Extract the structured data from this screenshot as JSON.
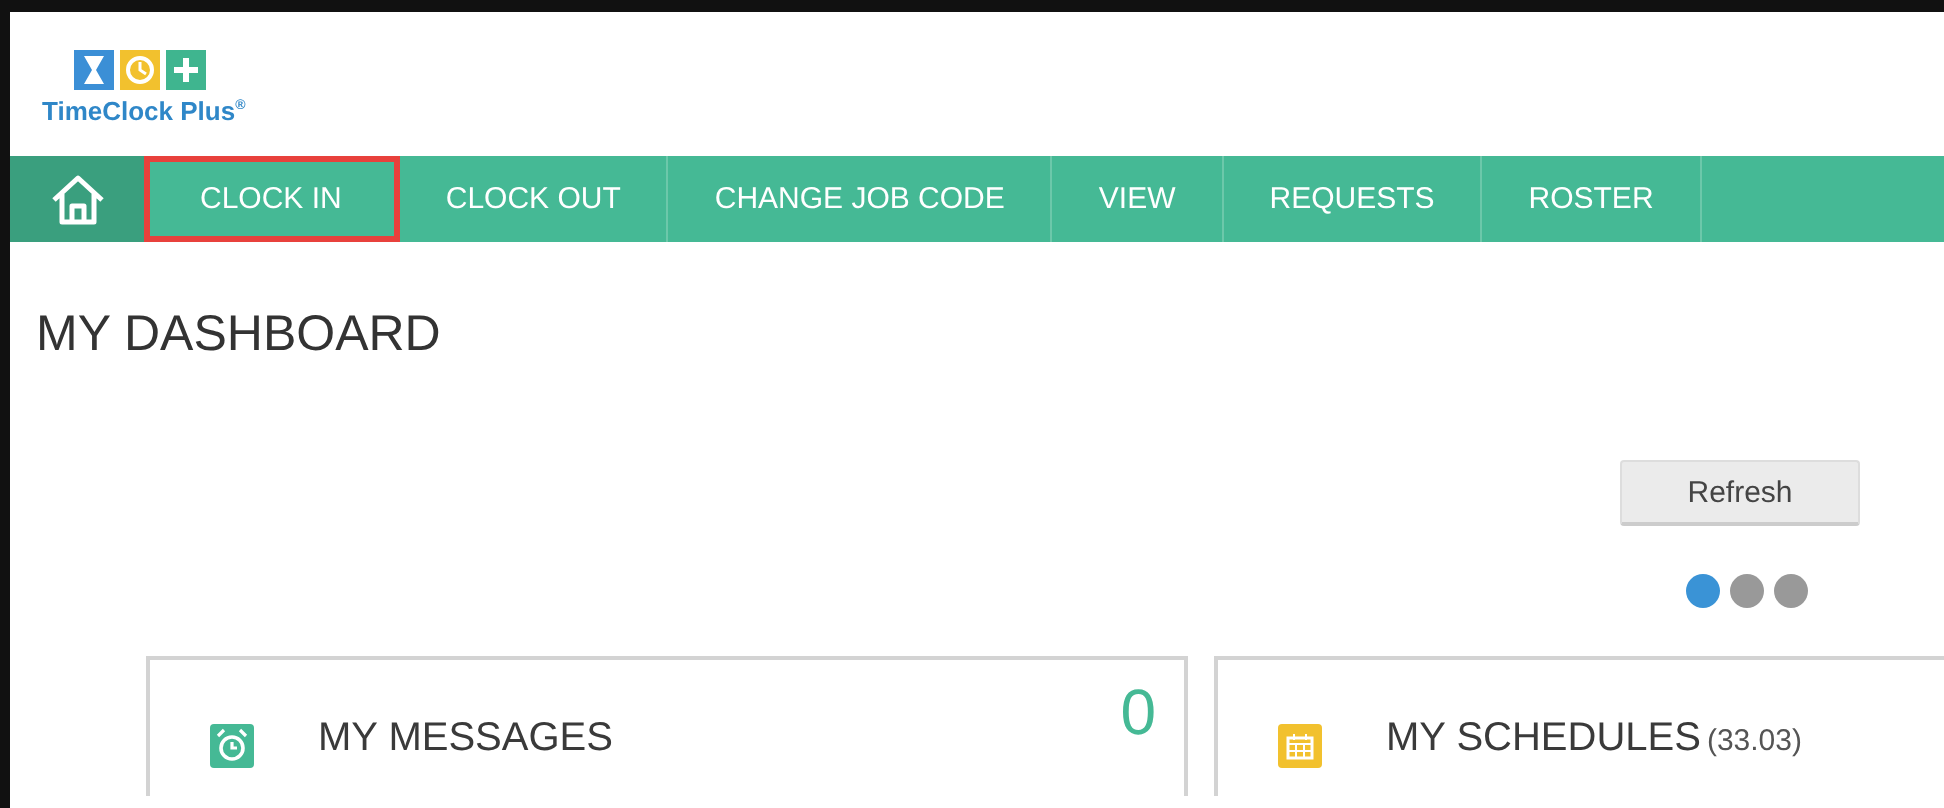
{
  "logo": {
    "text": "TimeClock Plus",
    "mark": "®"
  },
  "nav": {
    "items": [
      {
        "label": "CLOCK IN",
        "highlighted": true
      },
      {
        "label": "CLOCK OUT",
        "highlighted": false
      },
      {
        "label": "CHANGE JOB CODE",
        "highlighted": false
      },
      {
        "label": "VIEW",
        "highlighted": false
      },
      {
        "label": "REQUESTS",
        "highlighted": false
      },
      {
        "label": "ROSTER",
        "highlighted": false
      }
    ]
  },
  "page_title": "MY DASHBOARD",
  "refresh_button": "Refresh",
  "carousel_dots": [
    {
      "selected": true
    },
    {
      "selected": false
    },
    {
      "selected": false
    }
  ],
  "cards": [
    {
      "kind": "messages",
      "title": "MY MESSAGES",
      "count": "0"
    },
    {
      "kind": "schedules",
      "title": "MY SCHEDULES",
      "hours": "(33.03)"
    }
  ]
}
